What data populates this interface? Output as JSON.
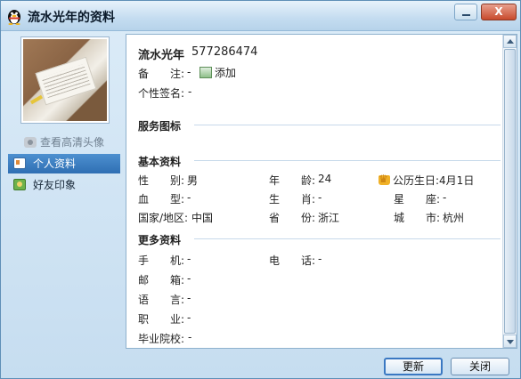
{
  "window": {
    "title": "流水光年的资料"
  },
  "sidebar": {
    "hd_avatar_link": "查看高清头像",
    "items": [
      {
        "label": "个人资料",
        "active": true
      },
      {
        "label": "好友印象",
        "active": false
      }
    ]
  },
  "profile": {
    "nickname": "流水光年",
    "qq_number": "577286474",
    "remark_label": "备　　注:",
    "remark_value": "-",
    "add_label": "添加",
    "signature_label": "个性签名:",
    "signature_value": "-"
  },
  "sections": {
    "service": "服务图标",
    "basic": "基本资料",
    "more": "更多资料"
  },
  "basic_info": {
    "gender_label": "性　　别:",
    "gender_value": "男",
    "age_label": "年　　龄:",
    "age_value": "24",
    "lunar_birthday_label": "公历生日:",
    "lunar_birthday_value": "4月1日",
    "blood_label": "血　　型:",
    "blood_value": "-",
    "zodiac_label": "生　　肖:",
    "zodiac_value": "-",
    "constellation_label": "星　　座:",
    "constellation_value": "-",
    "country_label": "国家/地区:",
    "country_value": "中国",
    "province_label": "省　　份:",
    "province_value": "浙江",
    "city_label": "城　　市:",
    "city_value": "杭州"
  },
  "more_info": {
    "mobile_label": "手　　机:",
    "mobile_value": "-",
    "phone_label": "电　　话:",
    "phone_value": "-",
    "email_label": "邮　　箱:",
    "email_value": "-",
    "language_label": "语　　言:",
    "language_value": "-",
    "job_label": "职　　业:",
    "job_value": "-",
    "school_label": "毕业院校:",
    "school_value": "-"
  },
  "buttons": {
    "refresh": "更新",
    "close": "关闭"
  },
  "titlebar": {
    "close_glyph": "X"
  },
  "colors": {
    "accent": "#3a78c2",
    "nav_active": "#3f80c2",
    "close": "#c84a2c"
  },
  "icons": [
    "qq-penguin-icon",
    "minimize-icon",
    "close-icon",
    "camera-icon",
    "profile-card-icon",
    "friend-impression-icon",
    "add-remark-icon",
    "crown-icon",
    "scroll-up-icon",
    "scroll-down-icon"
  ]
}
